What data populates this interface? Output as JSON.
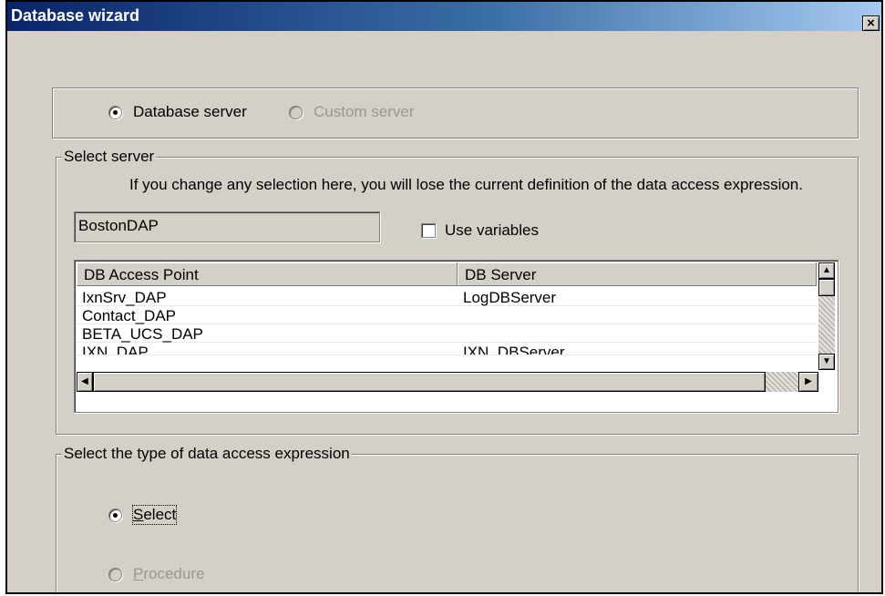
{
  "window": {
    "title": "Database wizard",
    "close_label": "×"
  },
  "server_type": {
    "database_server": "Database server",
    "custom_server": "Custom server"
  },
  "select_server": {
    "legend": "Select server",
    "warning": "If you change any selection here, you will lose the current definition of the data access expression.",
    "server_name": "BostonDAP",
    "use_variables": "Use variables"
  },
  "table": {
    "columns": [
      "DB Access Point",
      "DB Server"
    ],
    "rows": [
      [
        "IxnSrv_DAP",
        "LogDBServer"
      ],
      [
        "Contact_DAP",
        ""
      ],
      [
        "BETA_UCS_DAP",
        ""
      ],
      [
        "IXN_DAP",
        "IXN_DBServer"
      ]
    ]
  },
  "expression_type": {
    "legend": "Select the type of data access expression",
    "select_accel": "S",
    "select_rest": "elect",
    "procedure_accel": "P",
    "procedure_rest": "rocedure"
  },
  "colors": {
    "title_start": "#0a246a",
    "title_end": "#a6caf0",
    "face": "#d4d0c8",
    "disabled_text": "#9a978f"
  }
}
